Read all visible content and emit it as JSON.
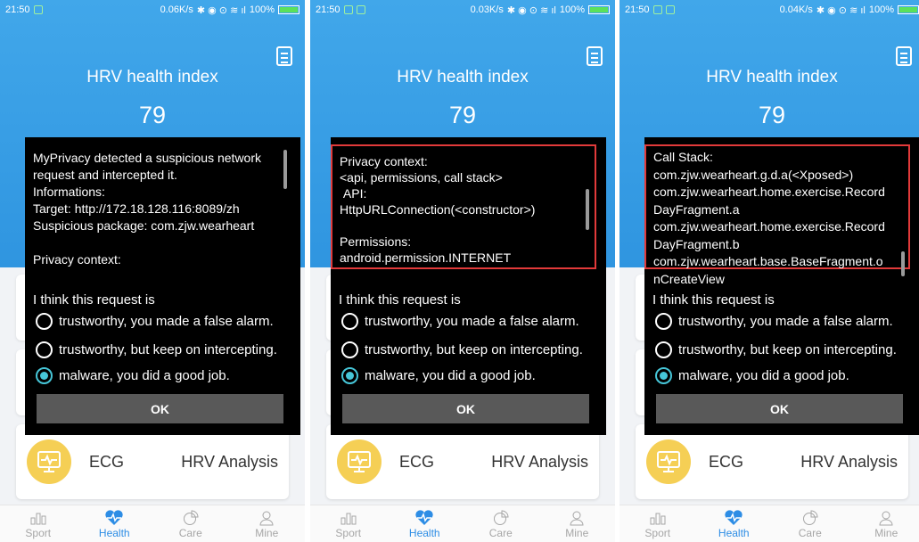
{
  "common": {
    "header_title": "HRV health index",
    "score": "79",
    "ecg_label": "ECG",
    "hrv_analysis_label": "HRV Analysis",
    "think_label": "I think this request is",
    "options": [
      "trustworthy, you made a false alarm.",
      "trustworthy, but keep on intercepting.",
      "malware, you did a good job."
    ],
    "selected_option": 2,
    "ok_label": "OK",
    "tabs": [
      "Sport",
      "Health",
      "Care",
      "Mine"
    ],
    "active_tab": "Health",
    "accent_color": "#2d8de5",
    "highlight_color": "#e23a3a"
  },
  "screens": [
    {
      "status_time": "21:50",
      "status_speed": "0.06K/s",
      "status_battery": "100%",
      "message": "MyPrivacy detected a suspicious network request and intercepted it.\nInformations:\nTarget: http://172.18.128.116:8089/zh\nSuspicious package: com.zjw.wearheart\n\nPrivacy context:"
    },
    {
      "status_time": "21:50",
      "status_speed": "0.03K/s",
      "status_battery": "100%",
      "context_text": "Privacy context:\n<api, permissions, call stack>\n API:\nHttpURLConnection(<constructor>)\n\nPermissions:\nandroid.permission.INTERNET"
    },
    {
      "status_time": "21:50",
      "status_speed": "0.04K/s",
      "status_battery": "100%",
      "context_text": "Call Stack:\ncom.zjw.wearheart.g.d.a(<Xposed>)\ncom.zjw.wearheart.home.exercise.Record\nDayFragment.a\ncom.zjw.wearheart.home.exercise.Record\nDayFragment.b\ncom.zjw.wearheart.base.BaseFragment.o\nnCreateView"
    }
  ]
}
